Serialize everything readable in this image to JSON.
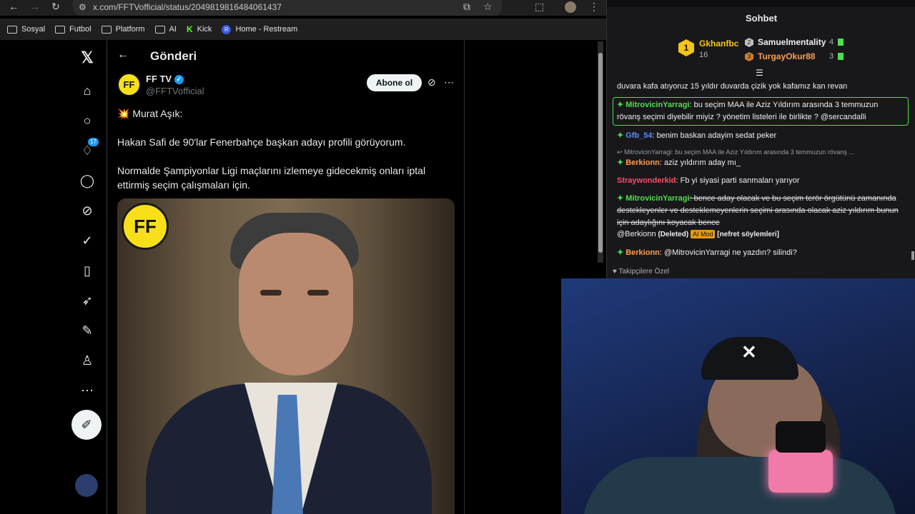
{
  "browser": {
    "url": "x.com/FFTVofficial/status/2049819816484061437",
    "bookmarks": [
      "Sosyal",
      "Futbol",
      "Platform",
      "AI",
      "Kick",
      "Home - Restream"
    ]
  },
  "x_nav": {
    "notification_count": "17"
  },
  "post_header": {
    "title": "Gönderi"
  },
  "tweet": {
    "name": "FF TV",
    "handle": "@FFTVofficial",
    "follow_label": "Abone ol",
    "line1": "💥 Murat Aşık:",
    "para1": "Hakan Safi de 90'lar Fenerbahçe başkan adayı profili görüyorum.",
    "para2": "Normalde Şampiyonlar Ligi maçlarını izlemeye gidecekmiş onları iptal ettirmiş seçim çalışmaları için.",
    "logo_text": "FF"
  },
  "chat": {
    "title": "Sohbet",
    "leaderboard": {
      "first_name": "Gkhanfbc",
      "first_count": "16",
      "first_rank": "1",
      "second_name": "Samuelmentality",
      "second_count": "4",
      "second_rank": "2",
      "third_name": "TurgayOkur88",
      "third_count": "3",
      "third_rank": "3"
    },
    "messages": [
      {
        "user": "",
        "text": "duvara kafa atıyoruz 15 yıldır duvarda çizik yok kafamız kan revan"
      },
      {
        "user": "MitrovicinYarragi",
        "text": ": bu seçim MAA ile Aziz Yıldırım arasında 3 temmuzun rövanş seçimi diyebilir miyiz ? yönetim listeleri ile birlikte ? @sercandalli"
      },
      {
        "user": "Gfb_54",
        "text": ": benim baskan adayim sedat peker"
      },
      {
        "user": "",
        "text": "MitrovicinYarragi: bu seçim MAA ile Aziz Yıldırım arasında 3 temmuzun rövanş ..."
      },
      {
        "user": "Berkionn",
        "text": ": aziz yıldırım aday mı_"
      },
      {
        "user": "Straywonderkid",
        "text": ": Fb yi siyasi parti sanmaları yarıyor"
      },
      {
        "user": "MitrovicinYarragi",
        "text": ": bence aday olacak ve bu seçim terör örgütünü zamanında destekleyenler ve desteklemeyenlerin seçimi arasında olacak aziz yıldırım bunun için adaylığını koyacak bence"
      },
      {
        "user": "@Berkionn",
        "text": "(Deleted)",
        "badge": "AI Mod",
        "note": "[nefret söylemleri]"
      },
      {
        "user": "Berkionn",
        "text": ": @MitrovicinYarragi ne yazdın? silindi?"
      }
    ],
    "footer": "Takipçilere Özel"
  },
  "colors": {
    "accent_blue": "#1d9bf0",
    "chat_green": "#4ce04c",
    "gold": "#f5c518",
    "ff_yellow": "#f7e01a"
  }
}
